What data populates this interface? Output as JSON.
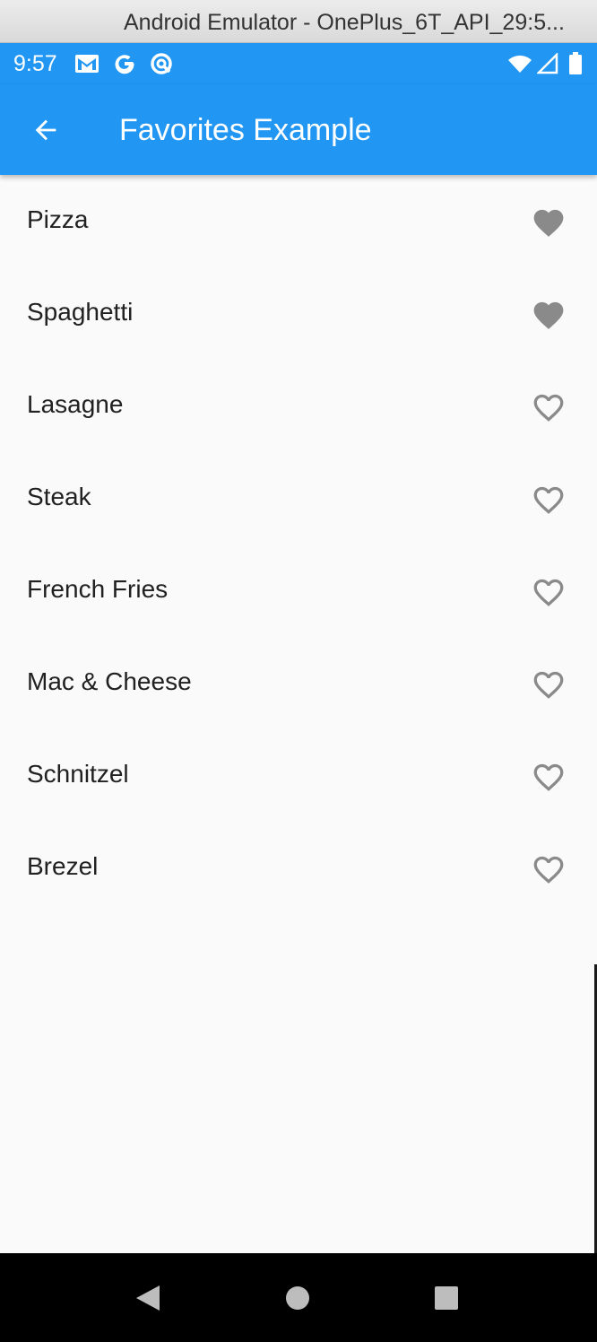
{
  "window": {
    "title": "Android Emulator - OnePlus_6T_API_29:5..."
  },
  "status_bar": {
    "time": "9:57",
    "left_icons": [
      "gmail-icon",
      "google-icon",
      "sync-icon"
    ],
    "right_icons": [
      "wifi-icon",
      "signal-icon",
      "battery-icon"
    ],
    "background": "#2196f3"
  },
  "app_bar": {
    "title": "Favorites Example",
    "back_icon": "arrow-back-icon",
    "background": "#2196f3"
  },
  "favorites": [
    {
      "name": "Pizza",
      "favorite": true
    },
    {
      "name": "Spaghetti",
      "favorite": true
    },
    {
      "name": "Lasagne",
      "favorite": false
    },
    {
      "name": "Steak",
      "favorite": false
    },
    {
      "name": "French Fries",
      "favorite": false
    },
    {
      "name": "Mac & Cheese",
      "favorite": false
    },
    {
      "name": "Schnitzel",
      "favorite": false
    },
    {
      "name": "Brezel",
      "favorite": false
    }
  ],
  "nav_bar": {
    "buttons": [
      "back-triangle-icon",
      "home-circle-icon",
      "recents-square-icon"
    ]
  },
  "colors": {
    "accent": "#2196f3",
    "heart": "#8a8a8a",
    "text": "#212121",
    "background": "#fafafa"
  }
}
